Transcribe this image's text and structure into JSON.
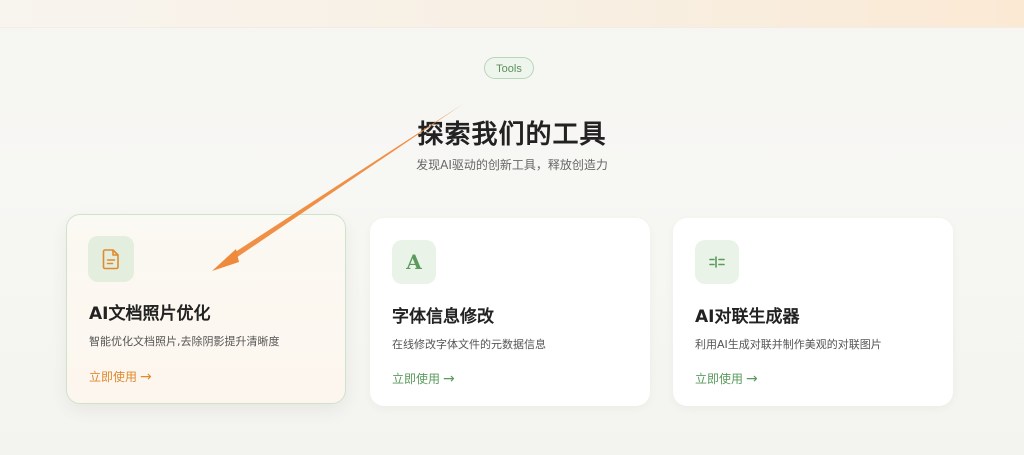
{
  "header": {
    "badge": "Tools",
    "title": "探索我们的工具",
    "subtitle": "发现AI驱动的创新工具，释放创造力"
  },
  "cards": [
    {
      "icon": "document-icon",
      "title": "AI文档照片优化",
      "description": "智能优化文档照片,去除阴影提升清晰度",
      "link": "立即使用",
      "link_arrow": "→",
      "accent": "#e08a2e"
    },
    {
      "icon": "font-a-icon",
      "icon_glyph": "A",
      "title": "字体信息修改",
      "description": "在线修改字体文件的元数据信息",
      "link": "立即使用",
      "link_arrow": "→",
      "accent": "#5a9a5c"
    },
    {
      "icon": "couplet-icon",
      "icon_glyph": "⫶=",
      "title": "AI对联生成器",
      "description": "利用AI生成对联并制作美观的对联图片",
      "link": "立即使用",
      "link_arrow": "→",
      "accent": "#5a9a5c"
    }
  ],
  "overlay": {
    "annotation": "orange-pointer-arrow",
    "color": "#ef8a3c"
  }
}
